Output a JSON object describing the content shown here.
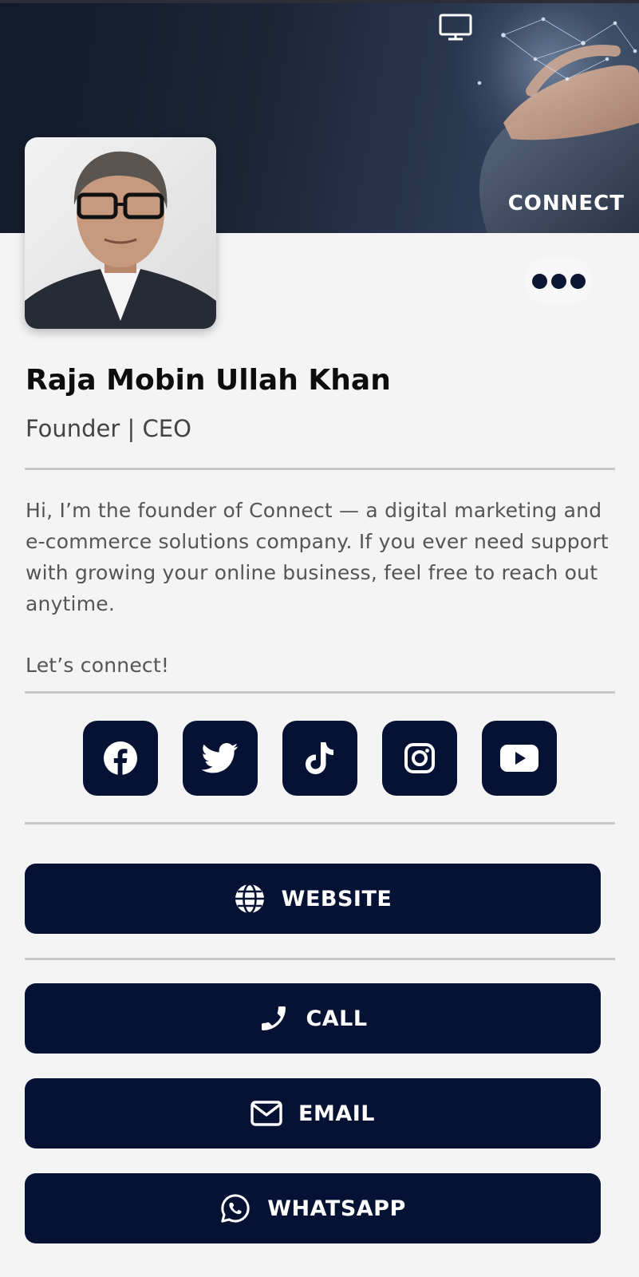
{
  "banner": {
    "brand": "CONNECT"
  },
  "profile": {
    "name": "Raja Mobin Ullah Khan",
    "title": "Founder | CEO",
    "bio": "Hi, I’m the founder of Connect — a digital marketing and e-commerce solutions company. If you ever need support with growing your online business, feel free to reach out anytime.",
    "closing": "Let’s connect!"
  },
  "socials": [
    {
      "icon": "facebook-icon"
    },
    {
      "icon": "twitter-icon"
    },
    {
      "icon": "tiktok-icon"
    },
    {
      "icon": "instagram-icon"
    },
    {
      "icon": "youtube-icon"
    }
  ],
  "actions": {
    "website": "WEBSITE",
    "call": "CALL",
    "email": "EMAIL",
    "whatsapp": "WHATSAPP"
  },
  "colors": {
    "primary": "#061233",
    "background": "#f4f4f4",
    "divider": "#c8c8c8"
  }
}
